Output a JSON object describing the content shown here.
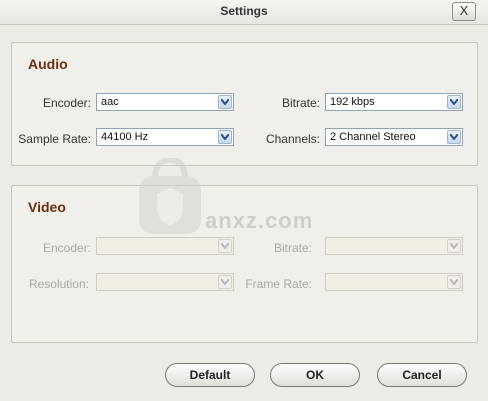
{
  "window": {
    "title": "Settings",
    "close_label": "X"
  },
  "audio": {
    "title": "Audio",
    "encoder": {
      "label": "Encoder:",
      "value": "aac"
    },
    "bitrate": {
      "label": "Bitrate:",
      "value": "192 kbps"
    },
    "sample_rate": {
      "label": "Sample Rate:",
      "value": "44100 Hz"
    },
    "channels": {
      "label": "Channels:",
      "value": "2 Channel Stereo"
    }
  },
  "video": {
    "title": "Video",
    "encoder": {
      "label": "Encoder:",
      "value": ""
    },
    "bitrate": {
      "label": "Bitrate:",
      "value": ""
    },
    "resolution": {
      "label": "Resolution:",
      "value": ""
    },
    "frame_rate": {
      "label": "Frame Rate:",
      "value": ""
    }
  },
  "buttons": {
    "default": "Default",
    "ok": "OK",
    "cancel": "Cancel"
  },
  "watermark": {
    "text": "anxz.com",
    "icon": "shield-lock-logo"
  }
}
